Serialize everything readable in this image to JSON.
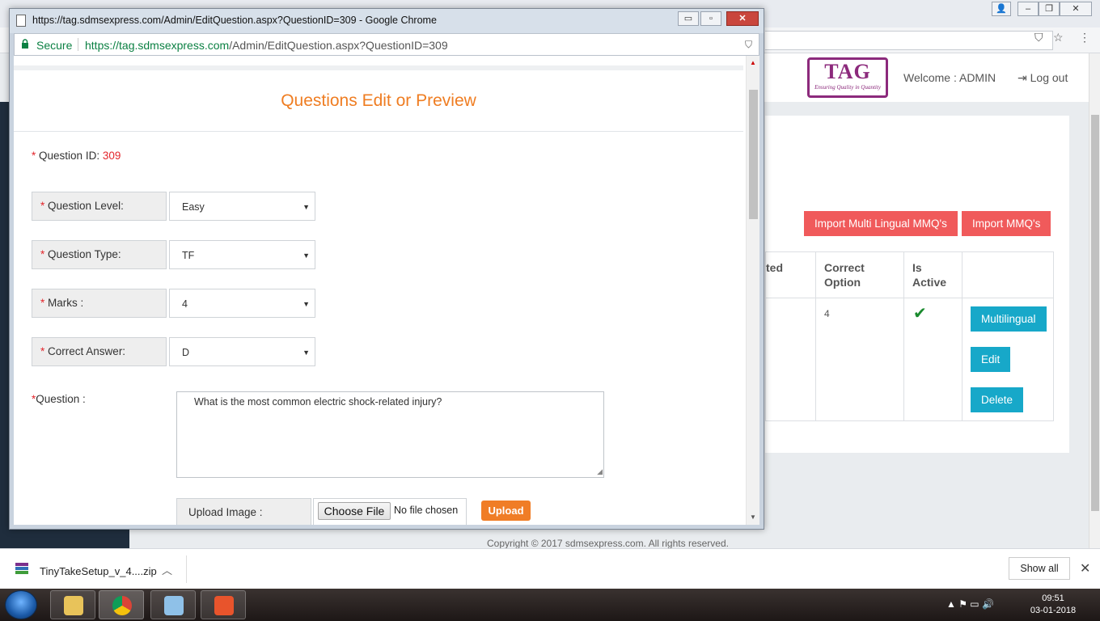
{
  "popup": {
    "title": "https://tag.sdmsexpress.com/Admin/EditQuestion.aspx?QuestionID=309 - Google Chrome",
    "window_min": "▭",
    "window_max": "▫",
    "window_close": "✕",
    "secure_label": "Secure",
    "url_host": "https://tag.sdmsexpress.com",
    "url_path": "/Admin/EditQuestion.aspx?QuestionID=309"
  },
  "form": {
    "heading": "Questions Edit or Preview",
    "required_mark": "*",
    "question_id_label": "Question ID:",
    "question_id_value": "309",
    "fields": [
      {
        "label": "Question Level:",
        "value": "Easy"
      },
      {
        "label": "Question Type:",
        "value": "TF"
      },
      {
        "label": " Marks :",
        "value": "4"
      },
      {
        "label": "Correct Answer:",
        "value": "D"
      }
    ],
    "question_label": "Question :",
    "question_text": "What is the most common electric shock-related injury?",
    "upload_label": "Upload Image :",
    "choose_file_label": "Choose File",
    "no_file_label": "No file chosen",
    "upload_button": "Upload"
  },
  "background": {
    "logo_text": "TAG",
    "logo_tagline": "Ensuring Quality in Quantity",
    "welcome": "Welcome : ADMIN",
    "logout": "Log out",
    "import_multilingual": "Import Multi Lingual MMQ's",
    "import_mmq": "Import MMQ's",
    "table": {
      "partial_header": "ted",
      "headers": [
        "Correct Option",
        "Is Active"
      ],
      "correct_option_value": "4",
      "actions": [
        "Multilingual",
        "Edit",
        "Delete"
      ]
    },
    "copyright": "Copyright © 2017 sdmsexpress.com. All rights reserved."
  },
  "downloads": {
    "file_name": "TinyTakeSetup_v_4....zip",
    "show_all": "Show all"
  },
  "taskbar": {
    "time": "09:51",
    "date": "03-01-2018"
  },
  "colors": {
    "accent_orange": "#ef7d22",
    "required_red": "#e3262c",
    "import_red": "#f05a5b",
    "action_teal": "#17a8c9",
    "secure_green": "#0b8043",
    "logo_purple": "#8c2a7c"
  }
}
